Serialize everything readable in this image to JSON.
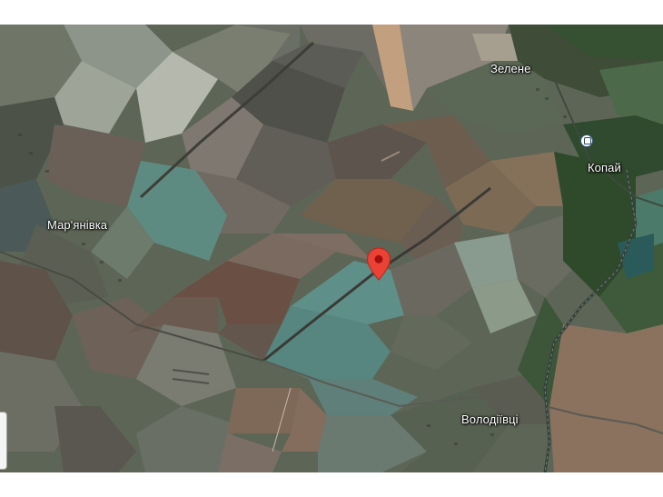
{
  "map": {
    "type": "satellite",
    "pin_icon": "location-pin-icon",
    "pin_color": "#ea4335",
    "transit_icon": "train-station-icon",
    "places": {
      "zelene": "Зелене",
      "kopai": "Копай",
      "marianivka": "Мар'янівка",
      "volodiivtsi": "Володіївці"
    }
  }
}
